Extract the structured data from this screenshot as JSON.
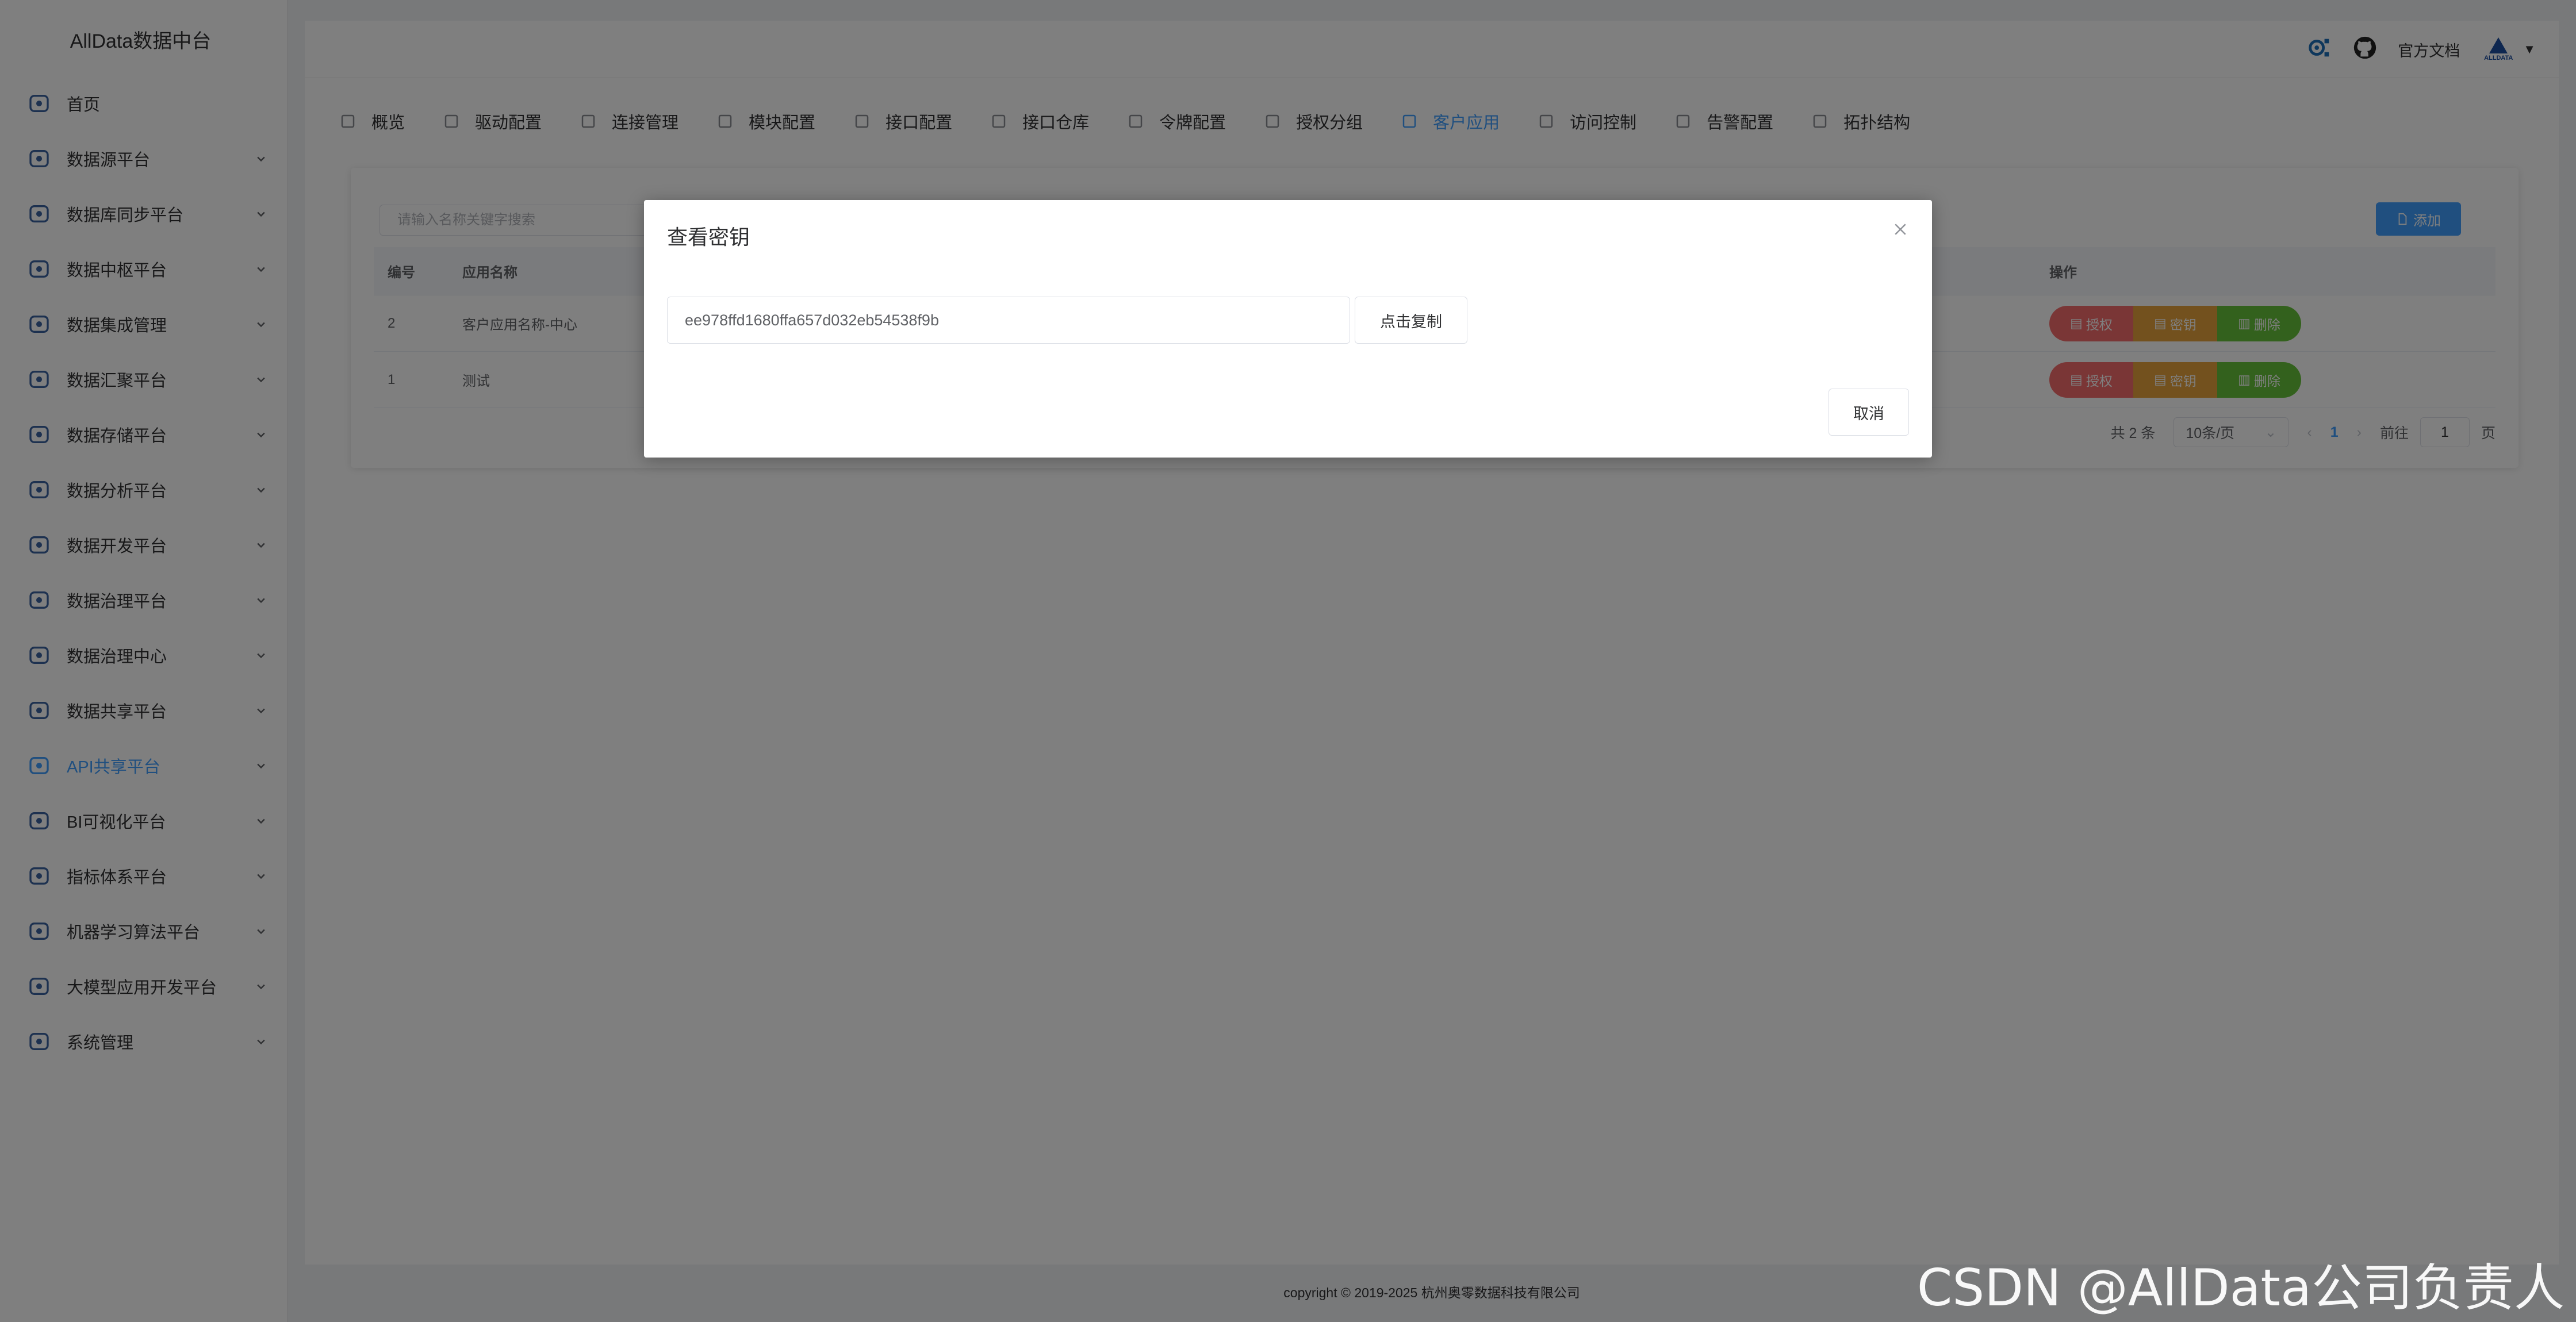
{
  "app": {
    "title": "AllData数据中台"
  },
  "sidebar": {
    "items": [
      {
        "label": "首页",
        "icon": "home-icon",
        "has_children": false
      },
      {
        "label": "数据源平台",
        "icon": "database-icon",
        "has_children": true
      },
      {
        "label": "数据库同步平台",
        "icon": "sync-search-icon",
        "has_children": true
      },
      {
        "label": "数据中枢平台",
        "icon": "grid-hub-icon",
        "has_children": true
      },
      {
        "label": "数据集成管理",
        "icon": "layers-icon",
        "has_children": true
      },
      {
        "label": "数据汇聚平台",
        "icon": "stack-icon",
        "has_children": true
      },
      {
        "label": "数据存储平台",
        "icon": "storage-chart-icon",
        "has_children": true
      },
      {
        "label": "数据分析平台",
        "icon": "analysis-icon",
        "has_children": true
      },
      {
        "label": "数据开发平台",
        "icon": "dev-grid-icon",
        "has_children": true
      },
      {
        "label": "数据治理平台",
        "icon": "shield-check-icon",
        "has_children": true
      },
      {
        "label": "数据治理中心",
        "icon": "calendar-check-icon",
        "has_children": true
      },
      {
        "label": "数据共享平台",
        "icon": "share-network-icon",
        "has_children": true
      },
      {
        "label": "API共享平台",
        "icon": "api-network-icon",
        "has_children": true,
        "active": true
      },
      {
        "label": "BI可视化平台",
        "icon": "monitor-icon",
        "has_children": true
      },
      {
        "label": "指标体系平台",
        "icon": "metrics-icon",
        "has_children": true
      },
      {
        "label": "机器学习算法平台",
        "icon": "ml-nodes-icon",
        "has_children": true
      },
      {
        "label": "大模型应用开发平台",
        "icon": "model-cycle-icon",
        "has_children": true
      },
      {
        "label": "系统管理",
        "icon": "settings-gear-icon",
        "has_children": true
      }
    ]
  },
  "header": {
    "docs_label": "官方文档",
    "avatar_text": "ALLDATA"
  },
  "tabs": [
    {
      "label": "概览",
      "icon": "dashboard-grid-icon"
    },
    {
      "label": "驱动配置",
      "icon": "driver-icon"
    },
    {
      "label": "连接管理",
      "icon": "connection-icon"
    },
    {
      "label": "模块配置",
      "icon": "folder-icon"
    },
    {
      "label": "接口配置",
      "icon": "interface-icon"
    },
    {
      "label": "接口仓库",
      "icon": "repository-icon"
    },
    {
      "label": "令牌配置",
      "icon": "token-icon"
    },
    {
      "label": "授权分组",
      "icon": "document-icon"
    },
    {
      "label": "客户应用",
      "icon": "pie-chart-icon",
      "active": true
    },
    {
      "label": "访问控制",
      "icon": "access-list-icon"
    },
    {
      "label": "告警配置",
      "icon": "bell-icon"
    },
    {
      "label": "拓扑结构",
      "icon": "link-icon"
    }
  ],
  "toolbar": {
    "search_placeholder": "请输入名称关键字搜索",
    "add_label": "添加"
  },
  "table": {
    "columns": [
      "编号",
      "应用名称",
      "操作"
    ],
    "rows": [
      {
        "id": "2",
        "name": "客户应用名称-中心"
      },
      {
        "id": "1",
        "name": "测试"
      }
    ],
    "actions": {
      "authorize": "授权",
      "secret": "密钥",
      "delete": "删除"
    }
  },
  "pagination": {
    "total": "共 2 条",
    "page_size": "10条/页",
    "current_page": "1",
    "goto_label": "前往",
    "goto_value": "1",
    "page_suffix": "页"
  },
  "footer": {
    "copyright": "copyright © 2019-2025 杭州奥零数据科技有限公司"
  },
  "dialog": {
    "title": "查看密钥",
    "key_value": "ee978ffd1680ffa657d032eb54538f9b",
    "copy_label": "点击复制",
    "cancel_label": "取消"
  },
  "watermark": "CSDN @AllData公司负责人",
  "colors": {
    "primary": "#409eff",
    "danger": "#f56c6c",
    "warning": "#e6a23c",
    "success": "#67c23a"
  }
}
